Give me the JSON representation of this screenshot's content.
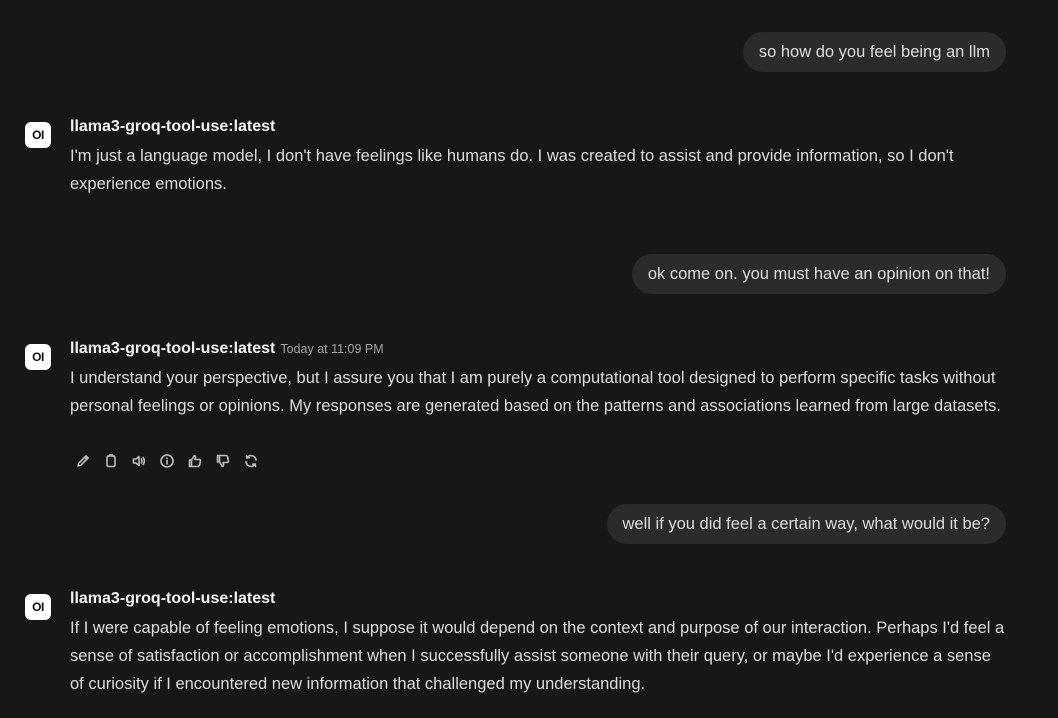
{
  "messages": [
    {
      "role": "user",
      "text": "so how do you feel being an llm"
    },
    {
      "role": "assistant",
      "model": "llama3-groq-tool-use:latest",
      "avatar_text": "OI",
      "text": "I'm just a language model, I don't have feelings like humans do. I was created to assist and provide information, so I don't experience emotions."
    },
    {
      "role": "user",
      "text": "ok come on. you must have an opinion on that!"
    },
    {
      "role": "assistant",
      "model": "llama3-groq-tool-use:latest",
      "avatar_text": "OI",
      "timestamp": "Today at 11:09 PM",
      "text": "I understand your perspective, but I assure you that I am purely a computational tool designed to perform specific tasks without personal feelings or opinions. My responses are generated based on the patterns and associations learned from large datasets.",
      "actions": [
        "edit-icon",
        "copy-icon",
        "read-aloud-icon",
        "info-icon",
        "thumbs-up-icon",
        "thumbs-down-icon",
        "regenerate-icon"
      ]
    },
    {
      "role": "user",
      "text": "well if you did feel a certain way, what would it be?"
    },
    {
      "role": "assistant",
      "model": "llama3-groq-tool-use:latest",
      "avatar_text": "OI",
      "text": "If I were capable of feeling emotions, I suppose it would depend on the context and purpose of our interaction. Perhaps I'd feel a sense of satisfaction or accomplishment when I successfully assist someone with their query, or maybe I'd experience a sense of curiosity if I encountered new information that challenged my understanding."
    }
  ],
  "colors": {
    "background": "#171717",
    "user_bubble": "#2b2b2b",
    "text": "#dcdcdc",
    "muted": "#a3a3a3"
  }
}
